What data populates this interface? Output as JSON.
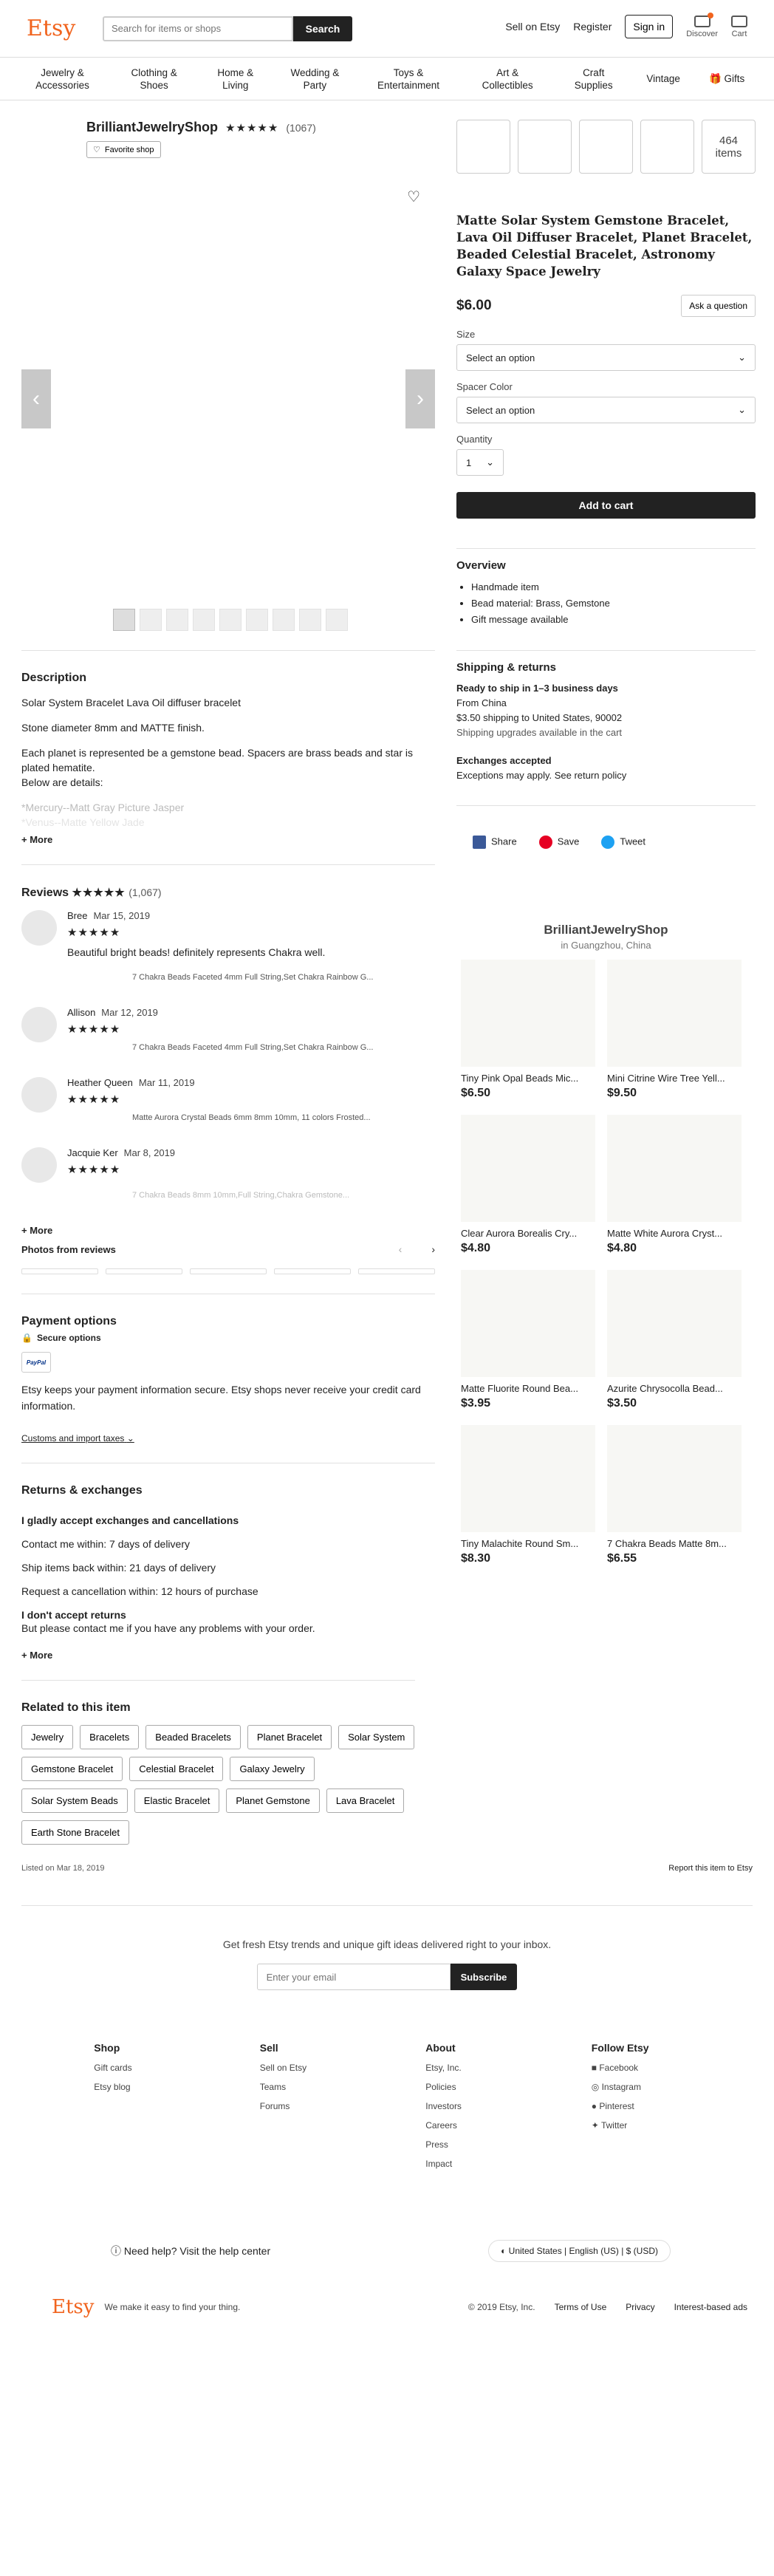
{
  "header": {
    "logo": "Etsy",
    "search_placeholder": "Search for items or shops",
    "search_btn": "Search",
    "sell": "Sell on Etsy",
    "register": "Register",
    "signin": "Sign in",
    "discover": "Discover",
    "cart": "Cart"
  },
  "categories": [
    "Jewelry & Accessories",
    "Clothing & Shoes",
    "Home & Living",
    "Wedding & Party",
    "Toys & Entertainment",
    "Art & Collectibles",
    "Craft Supplies",
    "Vintage",
    "Gifts"
  ],
  "shop": {
    "name": "BrilliantJewelryShop",
    "stars": "★★★★★",
    "count": "(1067)",
    "favorite": "Favorite shop",
    "items_count": "464",
    "items_label": "items"
  },
  "product": {
    "title": "Matte Solar System Gemstone Bracelet, Lava Oil Diffuser Bracelet, Planet Bracelet, Beaded Celestial Bracelet, Astronomy Galaxy Space Jewelry",
    "price": "$6.00",
    "ask": "Ask a question",
    "size_label": "Size",
    "size_value": "Select an option",
    "spacer_label": "Spacer Color",
    "spacer_value": "Select an option",
    "qty_label": "Quantity",
    "qty_value": "1",
    "add_to_cart": "Add to cart"
  },
  "overview": {
    "title": "Overview",
    "items": [
      "Handmade item",
      "Bead material: Brass, Gemstone",
      "Gift message available"
    ]
  },
  "shipping": {
    "title": "Shipping & returns",
    "ready": "Ready to ship in 1–3 business days",
    "from": "From China",
    "cost": "$3.50 shipping to",
    "dest": "United States, 90002",
    "upgrades": "Shipping upgrades available in the cart",
    "exch_title": "Exchanges accepted",
    "exch_text": "Exceptions may apply.",
    "policy": "See return policy"
  },
  "share": {
    "share": "Share",
    "save": "Save",
    "tweet": "Tweet"
  },
  "description": {
    "title": "Description",
    "p1": "Solar System Bracelet Lava Oil diffuser bracelet",
    "p2": "Stone diameter 8mm and MATTE finish.",
    "p3": "Each planet is represented be a gemstone bead. Spacers are brass beads and star is plated hematite.",
    "p4": "Below are details:",
    "p5": "*Mercury--Matt Gray Picture Jasper",
    "p6": "*Venus--Matte Yellow Jade",
    "more": "+ More"
  },
  "reviews": {
    "title": "Reviews",
    "stars": "★★★★★",
    "count": "(1,067)",
    "items": [
      {
        "name": "Bree",
        "date": "Mar 15, 2019",
        "stars": "★★★★★",
        "text": "Beautiful bright beads! definitely represents Chakra well.",
        "product": "7 Chakra Beads Faceted 4mm Full String,Set Chakra Rainbow G..."
      },
      {
        "name": "Allison",
        "date": "Mar 12, 2019",
        "stars": "★★★★★",
        "text": "",
        "product": "7 Chakra Beads Faceted 4mm Full String,Set Chakra Rainbow G..."
      },
      {
        "name": "Heather Queen",
        "date": "Mar 11, 2019",
        "stars": "★★★★★",
        "text": "",
        "product": "Matte Aurora Crystal Beads 6mm 8mm 10mm, 11 colors Frosted..."
      },
      {
        "name": "Jacquie Ker",
        "date": "Mar 8, 2019",
        "stars": "★★★★★",
        "text": "",
        "product": "7 Chakra Beads 8mm 10mm,Full String,Chakra Gemstone..."
      }
    ],
    "more": "+ More",
    "photos": "Photos from reviews"
  },
  "payment": {
    "title": "Payment options",
    "secure": "Secure options",
    "paypal": "PayPal",
    "text": "Etsy keeps your payment information secure. Etsy shops never receive your credit card information.",
    "customs": "Customs and import taxes"
  },
  "returns": {
    "title": "Returns & exchanges",
    "accept": "I gladly accept exchanges and cancellations",
    "contact": "Contact me within: 7 days of delivery",
    "ship": "Ship items back within: 21 days of delivery",
    "cancel": "Request a cancellation within: 12 hours of purchase",
    "noreturn": "I don't accept returns",
    "contact2": "But please contact me if you have any problems with your order.",
    "more": "+ More"
  },
  "related": {
    "title": "Related to this item",
    "tags": [
      "Jewelry",
      "Bracelets",
      "Beaded Bracelets",
      "Planet Bracelet",
      "Solar System",
      "Gemstone Bracelet",
      "Celestial Bracelet",
      "Galaxy Jewelry",
      "Solar System Beads",
      "Elastic Bracelet",
      "Planet Gemstone",
      "Lava Bracelet",
      "Earth Stone Bracelet"
    ],
    "listed": "Listed on Mar 18, 2019",
    "report": "Report this item to Etsy"
  },
  "shop_panel": {
    "name": "BrilliantJewelryShop",
    "location": "in Guangzhou, China",
    "items": [
      {
        "name": "Tiny Pink Opal Beads Mic...",
        "price": "$6.50"
      },
      {
        "name": "Mini Citrine Wire Tree Yell...",
        "price": "$9.50"
      },
      {
        "name": "Clear Aurora Borealis Cry...",
        "price": "$4.80"
      },
      {
        "name": "Matte White Aurora Cryst...",
        "price": "$4.80"
      },
      {
        "name": "Matte Fluorite Round Bea...",
        "price": "$3.95"
      },
      {
        "name": "Azurite Chrysocolla Bead...",
        "price": "$3.50"
      },
      {
        "name": "Tiny Malachite Round Sm...",
        "price": "$8.30"
      },
      {
        "name": "7 Chakra Beads Matte 8m...",
        "price": "$6.55"
      }
    ]
  },
  "newsletter": {
    "text": "Get fresh Etsy trends and unique gift ideas delivered right to your inbox.",
    "placeholder": "Enter your email",
    "btn": "Subscribe"
  },
  "footer": {
    "shop": {
      "title": "Shop",
      "links": [
        "Gift cards",
        "Etsy blog"
      ]
    },
    "sell": {
      "title": "Sell",
      "links": [
        "Sell on Etsy",
        "Teams",
        "Forums"
      ]
    },
    "about": {
      "title": "About",
      "links": [
        "Etsy, Inc.",
        "Policies",
        "Investors",
        "Careers",
        "Press",
        "Impact"
      ]
    },
    "follow": {
      "title": "Follow Etsy",
      "links": [
        "Facebook",
        "Instagram",
        "Pinterest",
        "Twitter"
      ]
    }
  },
  "help": {
    "text": "Need help? Visit the",
    "link": "help center",
    "country": "United States",
    "lang": "English (US)",
    "currency": "$ (USD)"
  },
  "bottom": {
    "logo": "Etsy",
    "tagline": "We make it easy to find your thing.",
    "copy": "© 2019 Etsy, Inc.",
    "terms": "Terms of Use",
    "privacy": "Privacy",
    "ads": "Interest-based ads"
  },
  "colors": {
    "brand": "#f1641e",
    "dark": "#222222"
  }
}
